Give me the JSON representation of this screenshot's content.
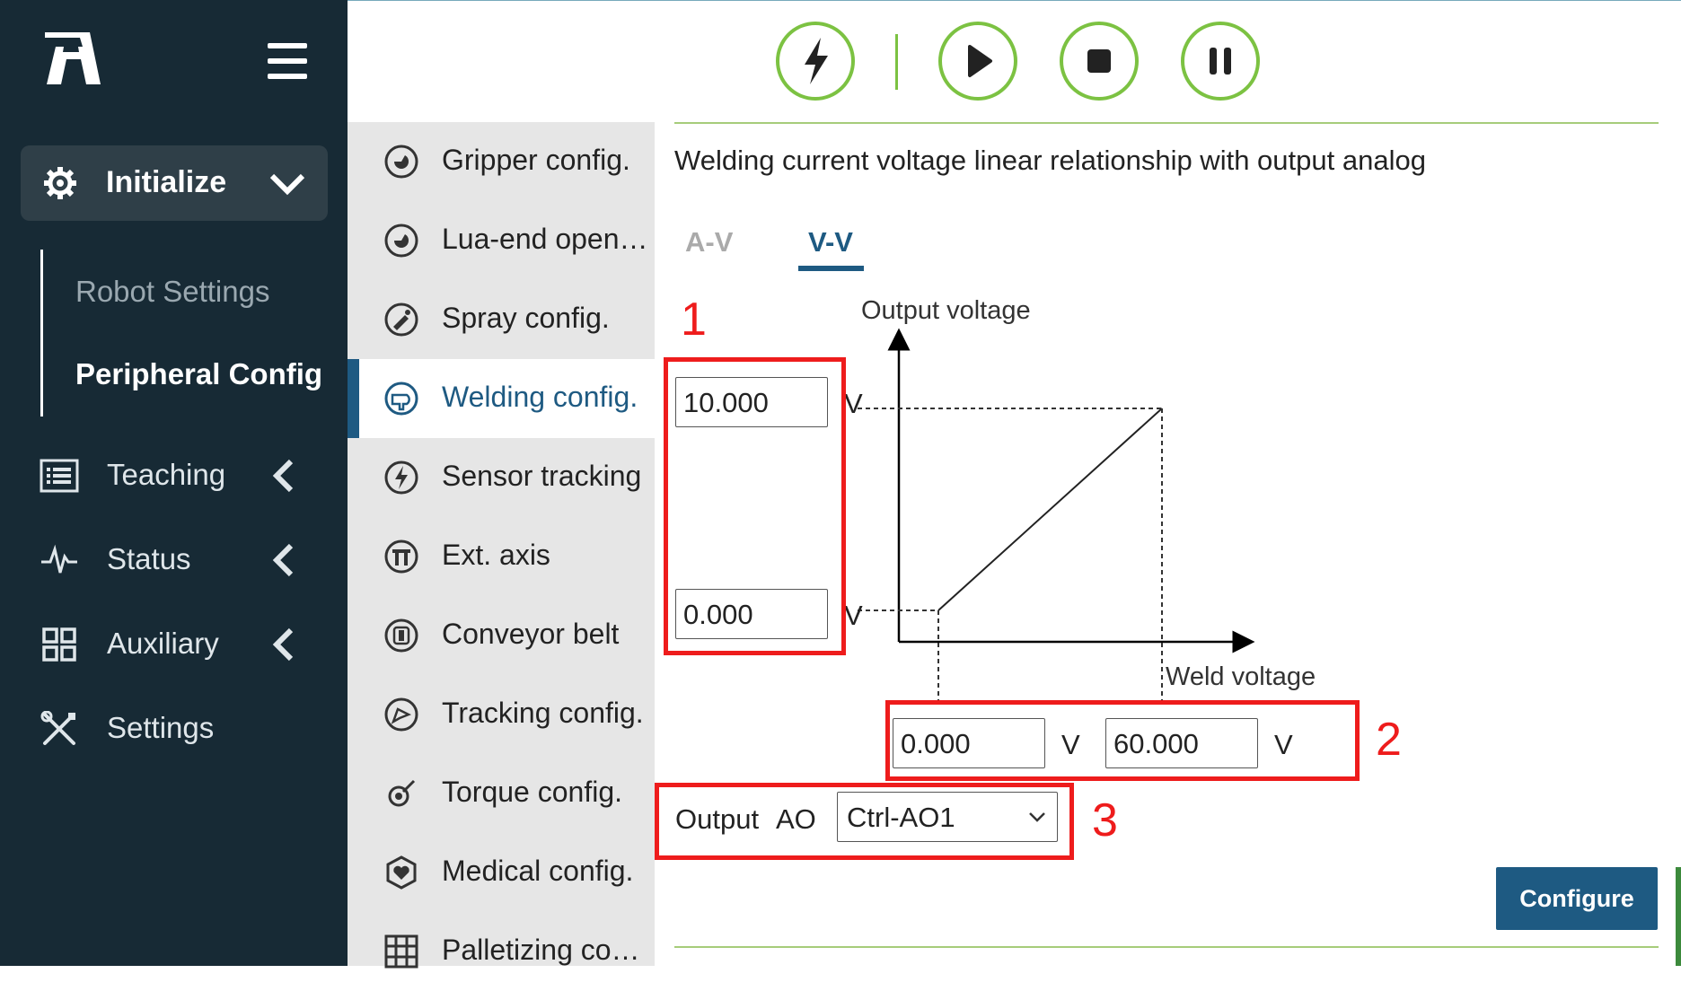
{
  "toolbar": {
    "buttons": [
      "enable-icon",
      "play-icon",
      "stop-icon",
      "pause-icon"
    ]
  },
  "sidebar": {
    "init_label": "Initialize",
    "sub_items": [
      "Robot Settings",
      "Peripheral Config"
    ],
    "items": [
      {
        "label": "Teaching",
        "icon": "list-icon"
      },
      {
        "label": "Status",
        "icon": "pulse-icon"
      },
      {
        "label": "Auxiliary",
        "icon": "grid-icon"
      },
      {
        "label": "Settings",
        "icon": "tools-icon"
      }
    ]
  },
  "menu": {
    "items": [
      {
        "label": "Gripper config."
      },
      {
        "label": "Lua-end open…"
      },
      {
        "label": "Spray config."
      },
      {
        "label": "Welding config."
      },
      {
        "label": "Sensor tracking"
      },
      {
        "label": "Ext. axis"
      },
      {
        "label": "Conveyor belt"
      },
      {
        "label": "Tracking config."
      },
      {
        "label": "Torque config."
      },
      {
        "label": "Medical config."
      },
      {
        "label": "Palletizing co…"
      }
    ],
    "active": "Welding config."
  },
  "main": {
    "title": "Welding current voltage linear relationship with output analog",
    "tabs": [
      "A-V",
      "V-V"
    ],
    "active_tab": "V-V",
    "graph": {
      "y_label": "Output voltage",
      "x_label": "Weld voltage"
    },
    "output_max": "10.000",
    "output_min": "0.000",
    "weld_min": "0.000",
    "weld_max": "60.000",
    "unit": "V",
    "output_label": "Output",
    "ao_label": "AO",
    "ao_select": "Ctrl-AO1",
    "annotations": [
      "1",
      "2",
      "3"
    ],
    "configure_label": "Configure"
  },
  "colors": {
    "sidebar_bg": "#172a35",
    "accent_blue": "#1e5a82",
    "toolbar_green": "#7cc242",
    "annotation_red": "#ee1c1c"
  }
}
